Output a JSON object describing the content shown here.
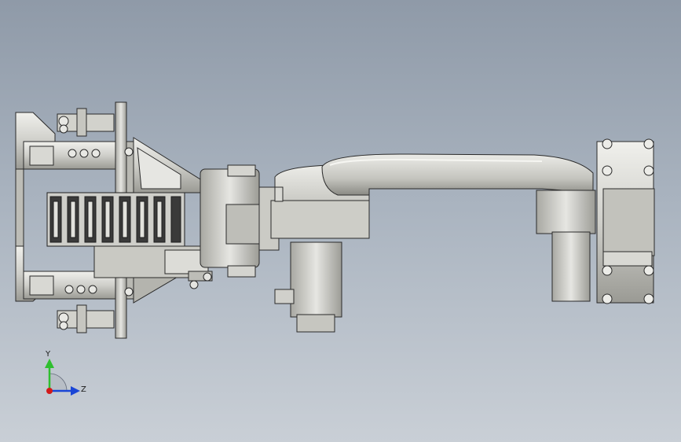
{
  "viewport": {
    "background_top": "#8f9aa8",
    "background_bottom": "#c9cfd6"
  },
  "model": {
    "part_colors": {
      "metal_light": "#e4e4e0",
      "metal_mid": "#c8c8c2",
      "metal_dark": "#8e8e88",
      "edge": "#2a2a2a",
      "chain": "#3a3a3a"
    }
  },
  "triad": {
    "y_label": "Y",
    "z_label": "Z",
    "y_color": "#2fbf2f",
    "z_color": "#1a46d6",
    "x_color": "#d21a1a"
  }
}
